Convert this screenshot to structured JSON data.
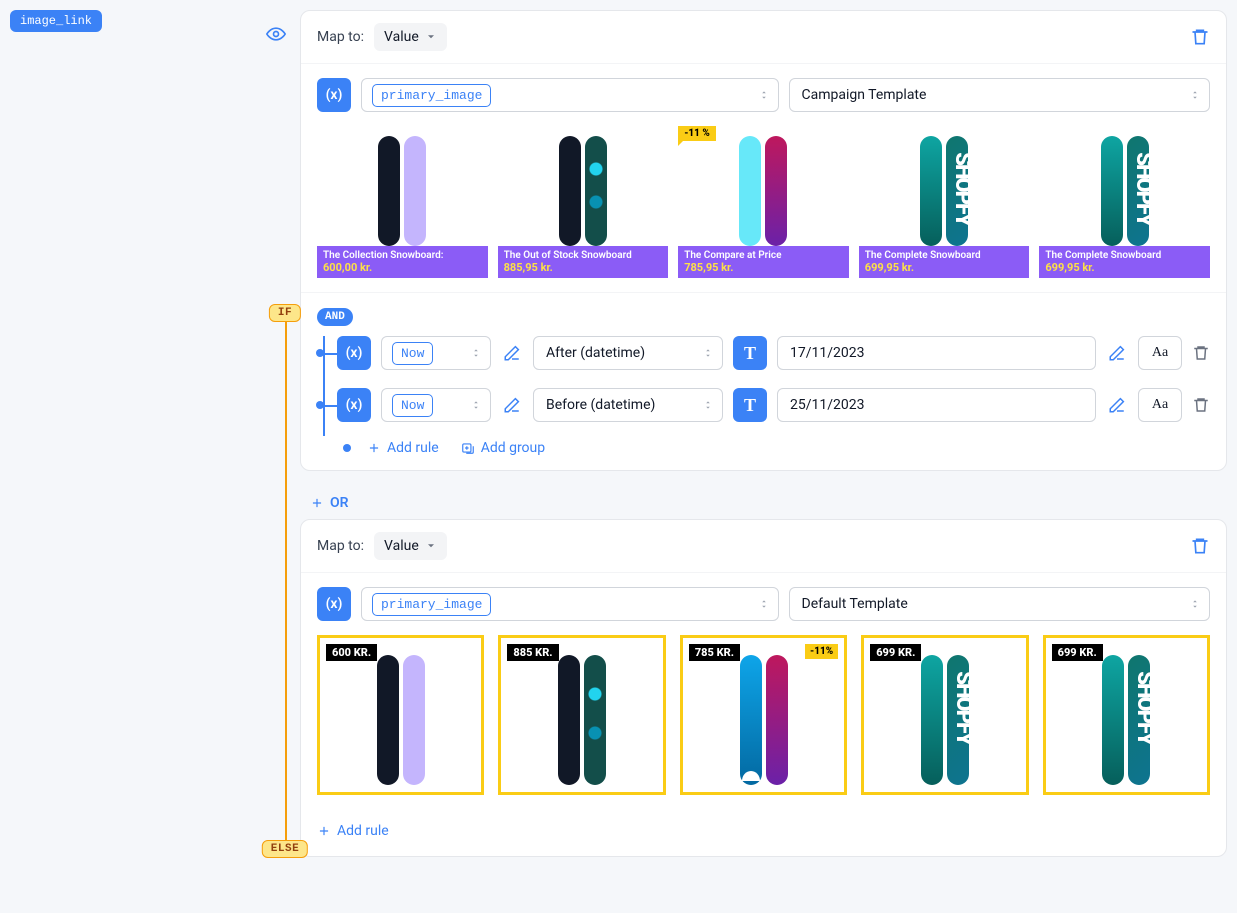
{
  "field_tag": "image_link",
  "flow": {
    "if": "IF",
    "else": "ELSE",
    "and": "AND",
    "or": "OR"
  },
  "map_to_label": "Map to:",
  "value_label": "Value",
  "variable": "primary_image",
  "templates": {
    "campaign": "Campaign Template",
    "default": "Default Template"
  },
  "operators": {
    "after": "After (datetime)",
    "before": "Before (datetime)"
  },
  "now": "Now",
  "add_rule": "Add rule",
  "add_group": "Add group",
  "conds": {
    "date1": "17/11/2023",
    "date2": "25/11/2023"
  },
  "products": [
    {
      "title": "The Collection Snowboard:",
      "price": "600,00 kr.",
      "disc": "",
      "tag": "600 KR.",
      "boards": [
        "b-dark",
        "b-lilac"
      ]
    },
    {
      "title": "The Out of Stock Snowboard",
      "price": "885,95 kr.",
      "disc": "",
      "tag": "885 KR.",
      "boards": [
        "b-dark",
        "b-tealdots"
      ]
    },
    {
      "title": "The Compare at Price",
      "price": "785,95 kr.",
      "disc": "-11 %",
      "tag": "785 KR.",
      "disc2": "-11%",
      "boards": [
        "b-cyan",
        "b-magenta"
      ]
    },
    {
      "title": "The Complete Snowboard",
      "price": "699,95 kr.",
      "disc": "",
      "tag": "699 KR.",
      "boards": [
        "b-teal",
        "b-shopfy"
      ]
    },
    {
      "title": "The Complete Snowboard",
      "price": "699,95 kr.",
      "disc": "",
      "tag": "699 KR.",
      "boards": [
        "b-teal",
        "b-shopfy"
      ]
    }
  ]
}
